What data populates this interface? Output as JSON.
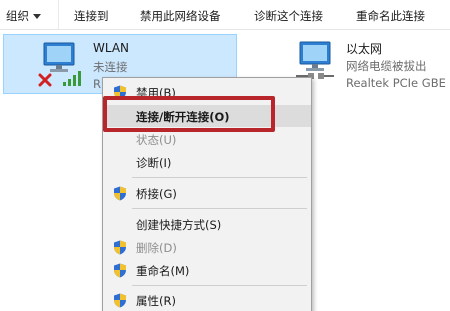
{
  "toolbar": {
    "organize": "组织",
    "connect_to": "连接到",
    "disable_device": "禁用此网络设备",
    "diagnose": "诊断这个连接",
    "rename": "重命名此连接"
  },
  "adapters": [
    {
      "name": "WLAN",
      "status": "未连接",
      "device": "R"
    },
    {
      "name": "以太网",
      "status": "网络电缆被拔出",
      "device": "Realtek PCIe GBE"
    }
  ],
  "context_menu": {
    "items": [
      {
        "label": "禁用(B)",
        "shield": true,
        "disabled": false
      },
      {
        "label": "连接/断开连接(O)",
        "shield": false,
        "disabled": false,
        "bold": true,
        "hover": true
      },
      {
        "label": "状态(U)",
        "shield": false,
        "disabled": true
      },
      {
        "label": "诊断(I)",
        "shield": false,
        "disabled": false
      },
      {
        "label": "桥接(G)",
        "shield": true,
        "disabled": false
      },
      {
        "label": "创建快捷方式(S)",
        "shield": false,
        "disabled": false
      },
      {
        "label": "删除(D)",
        "shield": true,
        "disabled": true
      },
      {
        "label": "重命名(M)",
        "shield": true,
        "disabled": false
      },
      {
        "label": "属性(R)",
        "shield": true,
        "disabled": false
      }
    ]
  },
  "colors": {
    "selection": "#cce8ff",
    "highlight_box": "#b8252a",
    "menu_bg": "#f2f2f2",
    "disabled_text": "#8d8d8d"
  },
  "icons": [
    "chevron-down-icon",
    "network-adapter-icon",
    "disconnected-x-icon",
    "wifi-signal-icon",
    "ethernet-unplugged-icon",
    "shield-icon"
  ]
}
